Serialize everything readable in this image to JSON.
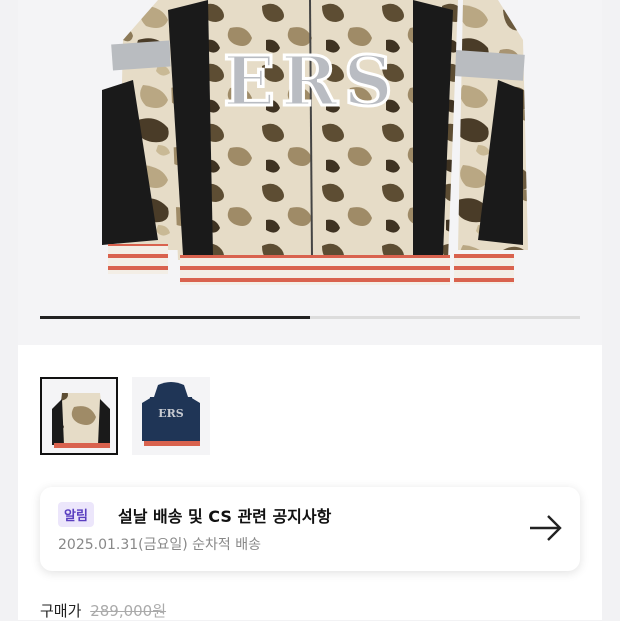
{
  "gallery": {
    "progress": 0.5,
    "jacket_letters": "ERS"
  },
  "thumbnails": [
    {
      "name": "camo",
      "selected": true
    },
    {
      "name": "navy",
      "selected": false
    }
  ],
  "notice": {
    "badge": "알림",
    "title": "설날 배송 및 CS 관련 공지사항",
    "subtitle": "2025.01.31(금요일) 순차적 배송",
    "arrow_icon": "arrow-right-icon"
  },
  "price": {
    "label": "구매가",
    "original": "289,000원"
  },
  "colors": {
    "badge_bg": "#ece6fb",
    "badge_text": "#5a3fc0",
    "camo_base": "#d8ccb4",
    "navy": "#1f3556",
    "stripe": "#d9624e"
  }
}
